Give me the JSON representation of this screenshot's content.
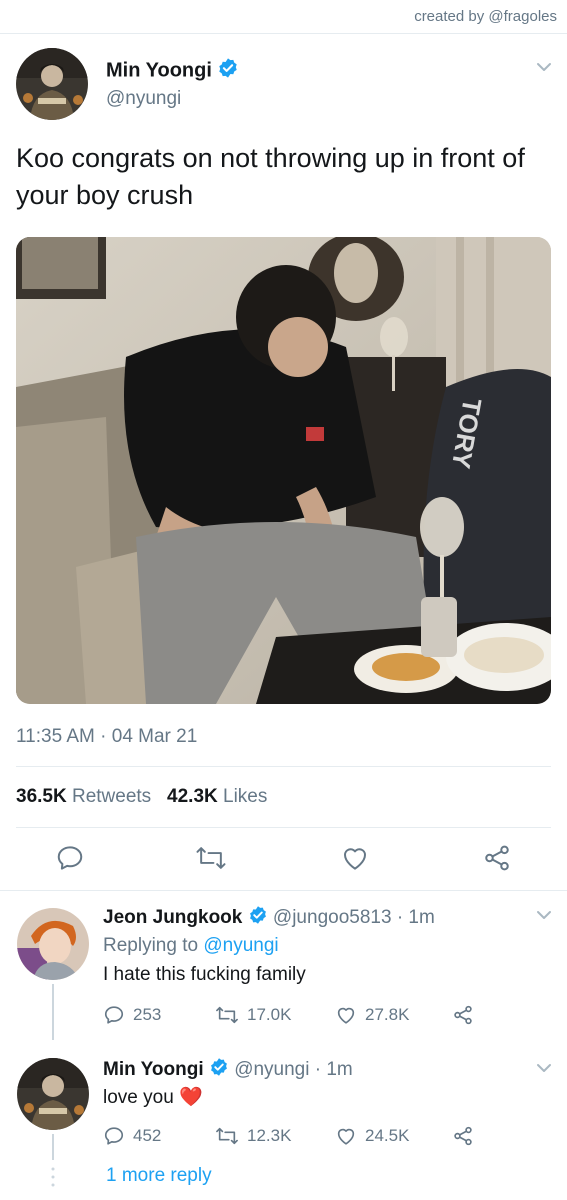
{
  "credit": "created by @fragoles",
  "tweet": {
    "name": "Min Yoongi",
    "handle": "@nyungi",
    "text": "Koo congrats on not throwing up in front of your boy crush",
    "time": "11:35 AM · 04 Mar 21",
    "retweets_count": "36.5K",
    "retweets_label": "Retweets",
    "likes_count": "42.3K",
    "likes_label": "Likes"
  },
  "replies": [
    {
      "name": "Jeon Jungkook",
      "handle": "@jungoo5813",
      "age": "· 1m",
      "replying_prefix": "Replying to",
      "replying_to": "@nyungi",
      "text": "I hate this fucking family",
      "replies": "253",
      "retweets": "17.0K",
      "likes": "27.8K"
    },
    {
      "name": "Min Yoongi",
      "handle": "@nyungi",
      "age": "· 1m",
      "text": "love you",
      "emoji": "❤️",
      "replies": "452",
      "retweets": "12.3K",
      "likes": "24.5K"
    }
  ],
  "more_replies": "1 more reply",
  "colors": {
    "accent": "#1da1f2",
    "muted": "#657786",
    "divider": "#e6ecf0",
    "heart": "#e0245e"
  }
}
